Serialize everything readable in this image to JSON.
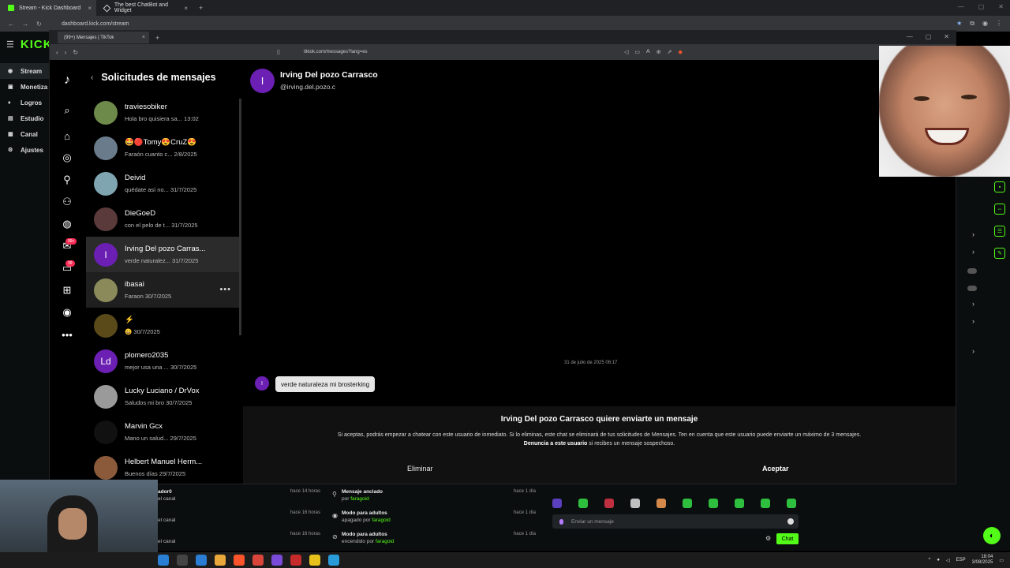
{
  "outer_browser": {
    "tabs": [
      {
        "title": "Stream - Kick Dashboard"
      },
      {
        "title": "The best ChatBot and Widget"
      }
    ],
    "url": "dashboard.kick.com/stream"
  },
  "kick_sidebar": {
    "logo": "KICK",
    "items": [
      {
        "label": "Stream"
      },
      {
        "label": "Monetiza"
      },
      {
        "label": "Logros"
      },
      {
        "label": "Estudio"
      },
      {
        "label": "Canal"
      },
      {
        "label": "Ajustes"
      }
    ]
  },
  "tiktok_window": {
    "tab_title": "(99+) Mensajes | TikTok",
    "url": "tiktok.com/messages?lang=es",
    "rail_badges": {
      "inbox": "99+",
      "messages": "39"
    }
  },
  "requests": {
    "title": "Solicitudes de mensajes",
    "items": [
      {
        "name": "traviesobiker",
        "preview": "Hola bro quisiera sa... 13:02",
        "avatar_color": "#6d8a4a"
      },
      {
        "name": "🤩🔴Tomy😍CruZ😍",
        "preview": "Faraón cuanto c... 2/8/2025",
        "avatar_color": "#6a7c8c"
      },
      {
        "name": "Deivid",
        "preview": "quédate así no... 31/7/2025",
        "avatar_color": "#7fa6b0"
      },
      {
        "name": "DieGoeD",
        "preview": "con el pelo de t... 31/7/2025",
        "avatar_color": "#5a3a3a"
      },
      {
        "name": "Irving Del pozo Carras...",
        "preview": "verde naturalez... 31/7/2025",
        "avatar_letter": "I",
        "avatar_color": "#6b1fb3"
      },
      {
        "name": "ibasai",
        "preview": "Faraon 30/7/2025",
        "avatar_color": "#8a8a5a"
      },
      {
        "name": "⚡",
        "preview": "😀 30/7/2025",
        "avatar_color": "#5a4a1a"
      },
      {
        "name": "plomero2035",
        "preview": "mejor usa una ... 30/7/2025",
        "avatar_letter": "Ld",
        "avatar_color": "#6b1fb3"
      },
      {
        "name": "Lucky Luciano / DrVox",
        "preview": "Saludos mi bro 30/7/2025",
        "avatar_color": "#9a9a9a"
      },
      {
        "name": "Marvin Gcx",
        "preview": "Mano un salud... 29/7/2025",
        "avatar_color": "#111111"
      },
      {
        "name": "Helbert Manuel Herm...",
        "preview": "Buenos días 29/7/2025",
        "avatar_color": "#8a5a3a"
      }
    ],
    "more_label": "•••"
  },
  "conversation": {
    "avatar_letter": "I",
    "name": "Irving Del pozo Carrasco",
    "handle": "@irving.del.pozo.c",
    "date": "31 de julio de 2025 06:17",
    "message": "verde naturaleza mi brosterking",
    "request_title": "Irving Del pozo Carrasco quiere enviarte un mensaje",
    "request_text": "Si aceptas, podrás empezar a chatear con este usuario de inmediato. Si lo eliminas, este chat se eliminará de tus solicitudes de Mensajes. Ten en cuenta que este usuario puede enviarte un máximo de 3 mensajes.",
    "report_link": "Denuncia a este usuario",
    "report_suffix": " si recibes un mensaje sospechoso.",
    "delete_label": "Eliminar",
    "accept_label": "Aceptar"
  },
  "activity": {
    "left": [
      {
        "title": "ador0",
        "sub": "el canal",
        "time": "hace 14 horas"
      },
      {
        "title": "",
        "sub": "el canal",
        "time": "hace 16 horas"
      },
      {
        "title": "",
        "sub": "el canal",
        "time": "hace 16 horas"
      }
    ],
    "middle": [
      {
        "title": "Mensaje anclado",
        "sub_pre": "por ",
        "sub_user": "faragoid",
        "time": "hace 1 día"
      },
      {
        "title": "Modo para adultos",
        "sub_pre": "apagado por ",
        "sub_user": "faragoid",
        "time": "hace 1 día"
      },
      {
        "title": "Modo para adultos",
        "sub_pre": "encendido por ",
        "sub_user": "faragoid",
        "time": "hace 1 día"
      }
    ]
  },
  "chat": {
    "placeholder": "Enviar un mensaje",
    "send_label": "Chat",
    "emote_colors": [
      "#5a3fbf",
      "#2fbf3f",
      "#bf2f3f",
      "#bfbfbf",
      "#d4884a",
      "#2fbf3f",
      "#2fbf3f",
      "#2fbf3f",
      "#2fbf3f",
      "#2fbf3f"
    ]
  },
  "taskbar": {
    "lang": "ESP",
    "time": "18:04",
    "date": "3/08/2025"
  },
  "colors": {
    "kick_green": "#53fc18",
    "tiktok_red": "#fe2c55",
    "avatar_purple": "#6b1fb3"
  }
}
